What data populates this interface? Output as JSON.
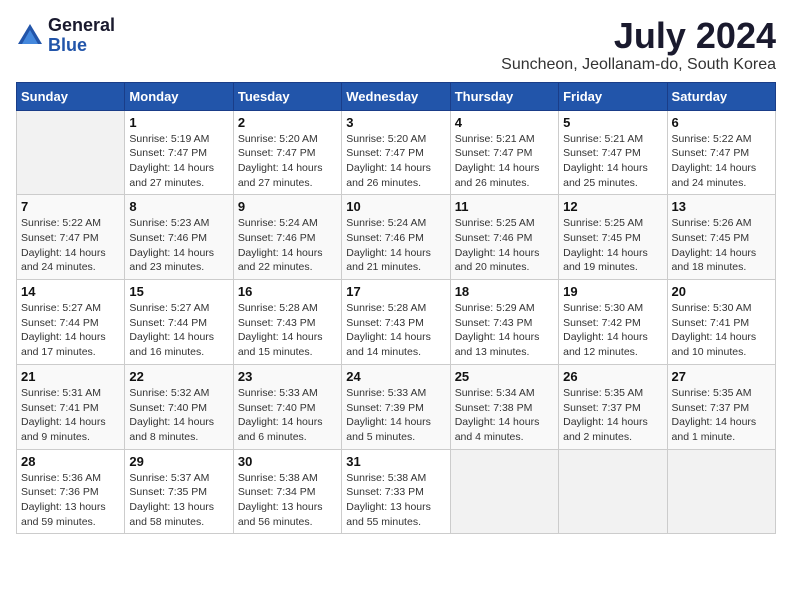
{
  "logo": {
    "general": "General",
    "blue": "Blue"
  },
  "title": "July 2024",
  "subtitle": "Suncheon, Jeollanam-do, South Korea",
  "headers": [
    "Sunday",
    "Monday",
    "Tuesday",
    "Wednesday",
    "Thursday",
    "Friday",
    "Saturday"
  ],
  "weeks": [
    [
      {
        "day": "",
        "info": ""
      },
      {
        "day": "1",
        "info": "Sunrise: 5:19 AM\nSunset: 7:47 PM\nDaylight: 14 hours\nand 27 minutes."
      },
      {
        "day": "2",
        "info": "Sunrise: 5:20 AM\nSunset: 7:47 PM\nDaylight: 14 hours\nand 27 minutes."
      },
      {
        "day": "3",
        "info": "Sunrise: 5:20 AM\nSunset: 7:47 PM\nDaylight: 14 hours\nand 26 minutes."
      },
      {
        "day": "4",
        "info": "Sunrise: 5:21 AM\nSunset: 7:47 PM\nDaylight: 14 hours\nand 26 minutes."
      },
      {
        "day": "5",
        "info": "Sunrise: 5:21 AM\nSunset: 7:47 PM\nDaylight: 14 hours\nand 25 minutes."
      },
      {
        "day": "6",
        "info": "Sunrise: 5:22 AM\nSunset: 7:47 PM\nDaylight: 14 hours\nand 24 minutes."
      }
    ],
    [
      {
        "day": "7",
        "info": "Sunrise: 5:22 AM\nSunset: 7:47 PM\nDaylight: 14 hours\nand 24 minutes."
      },
      {
        "day": "8",
        "info": "Sunrise: 5:23 AM\nSunset: 7:46 PM\nDaylight: 14 hours\nand 23 minutes."
      },
      {
        "day": "9",
        "info": "Sunrise: 5:24 AM\nSunset: 7:46 PM\nDaylight: 14 hours\nand 22 minutes."
      },
      {
        "day": "10",
        "info": "Sunrise: 5:24 AM\nSunset: 7:46 PM\nDaylight: 14 hours\nand 21 minutes."
      },
      {
        "day": "11",
        "info": "Sunrise: 5:25 AM\nSunset: 7:46 PM\nDaylight: 14 hours\nand 20 minutes."
      },
      {
        "day": "12",
        "info": "Sunrise: 5:25 AM\nSunset: 7:45 PM\nDaylight: 14 hours\nand 19 minutes."
      },
      {
        "day": "13",
        "info": "Sunrise: 5:26 AM\nSunset: 7:45 PM\nDaylight: 14 hours\nand 18 minutes."
      }
    ],
    [
      {
        "day": "14",
        "info": "Sunrise: 5:27 AM\nSunset: 7:44 PM\nDaylight: 14 hours\nand 17 minutes."
      },
      {
        "day": "15",
        "info": "Sunrise: 5:27 AM\nSunset: 7:44 PM\nDaylight: 14 hours\nand 16 minutes."
      },
      {
        "day": "16",
        "info": "Sunrise: 5:28 AM\nSunset: 7:43 PM\nDaylight: 14 hours\nand 15 minutes."
      },
      {
        "day": "17",
        "info": "Sunrise: 5:28 AM\nSunset: 7:43 PM\nDaylight: 14 hours\nand 14 minutes."
      },
      {
        "day": "18",
        "info": "Sunrise: 5:29 AM\nSunset: 7:43 PM\nDaylight: 14 hours\nand 13 minutes."
      },
      {
        "day": "19",
        "info": "Sunrise: 5:30 AM\nSunset: 7:42 PM\nDaylight: 14 hours\nand 12 minutes."
      },
      {
        "day": "20",
        "info": "Sunrise: 5:30 AM\nSunset: 7:41 PM\nDaylight: 14 hours\nand 10 minutes."
      }
    ],
    [
      {
        "day": "21",
        "info": "Sunrise: 5:31 AM\nSunset: 7:41 PM\nDaylight: 14 hours\nand 9 minutes."
      },
      {
        "day": "22",
        "info": "Sunrise: 5:32 AM\nSunset: 7:40 PM\nDaylight: 14 hours\nand 8 minutes."
      },
      {
        "day": "23",
        "info": "Sunrise: 5:33 AM\nSunset: 7:40 PM\nDaylight: 14 hours\nand 6 minutes."
      },
      {
        "day": "24",
        "info": "Sunrise: 5:33 AM\nSunset: 7:39 PM\nDaylight: 14 hours\nand 5 minutes."
      },
      {
        "day": "25",
        "info": "Sunrise: 5:34 AM\nSunset: 7:38 PM\nDaylight: 14 hours\nand 4 minutes."
      },
      {
        "day": "26",
        "info": "Sunrise: 5:35 AM\nSunset: 7:37 PM\nDaylight: 14 hours\nand 2 minutes."
      },
      {
        "day": "27",
        "info": "Sunrise: 5:35 AM\nSunset: 7:37 PM\nDaylight: 14 hours\nand 1 minute."
      }
    ],
    [
      {
        "day": "28",
        "info": "Sunrise: 5:36 AM\nSunset: 7:36 PM\nDaylight: 13 hours\nand 59 minutes."
      },
      {
        "day": "29",
        "info": "Sunrise: 5:37 AM\nSunset: 7:35 PM\nDaylight: 13 hours\nand 58 minutes."
      },
      {
        "day": "30",
        "info": "Sunrise: 5:38 AM\nSunset: 7:34 PM\nDaylight: 13 hours\nand 56 minutes."
      },
      {
        "day": "31",
        "info": "Sunrise: 5:38 AM\nSunset: 7:33 PM\nDaylight: 13 hours\nand 55 minutes."
      },
      {
        "day": "",
        "info": ""
      },
      {
        "day": "",
        "info": ""
      },
      {
        "day": "",
        "info": ""
      }
    ]
  ]
}
